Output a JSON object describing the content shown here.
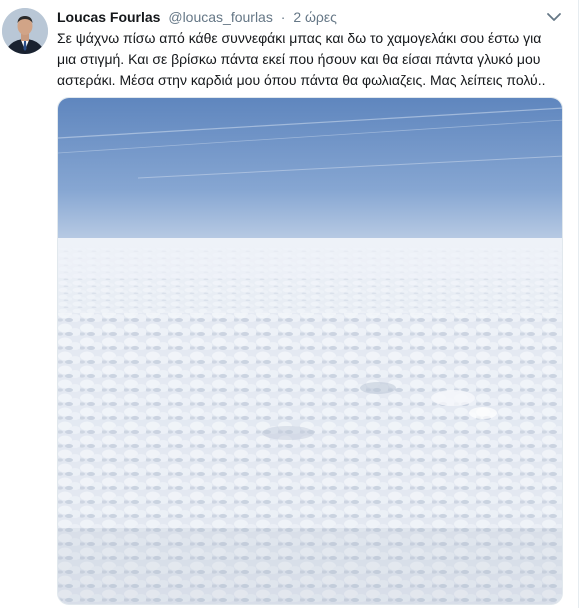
{
  "tweet": {
    "author_name": "Loucas Fourlas",
    "author_handle": "@loucas_fourlas",
    "separator": "·",
    "timestamp": "2 ώρες",
    "text_lines": [
      "Σε ψάχνω πίσω από κάθε συννεφάκι μπας και δω το χαμογελάκι σου έστω για",
      "μια στιγμή. Και σε βρίσκω πάντα εκεί που ήσουν και θα είσαι πάντα γλυκό μου",
      "αστεράκι. Μέσα στην καρδιά μου όπου πάντα θα φωλιαζεις. Μας λείπεις πολύ.."
    ],
    "icons": {
      "avatar": "profile-photo",
      "caret": "chevron-down-icon"
    },
    "colors": {
      "handle": "#657786",
      "sky_top": "#6f93c7",
      "clouds": "#e6ebf3"
    }
  }
}
